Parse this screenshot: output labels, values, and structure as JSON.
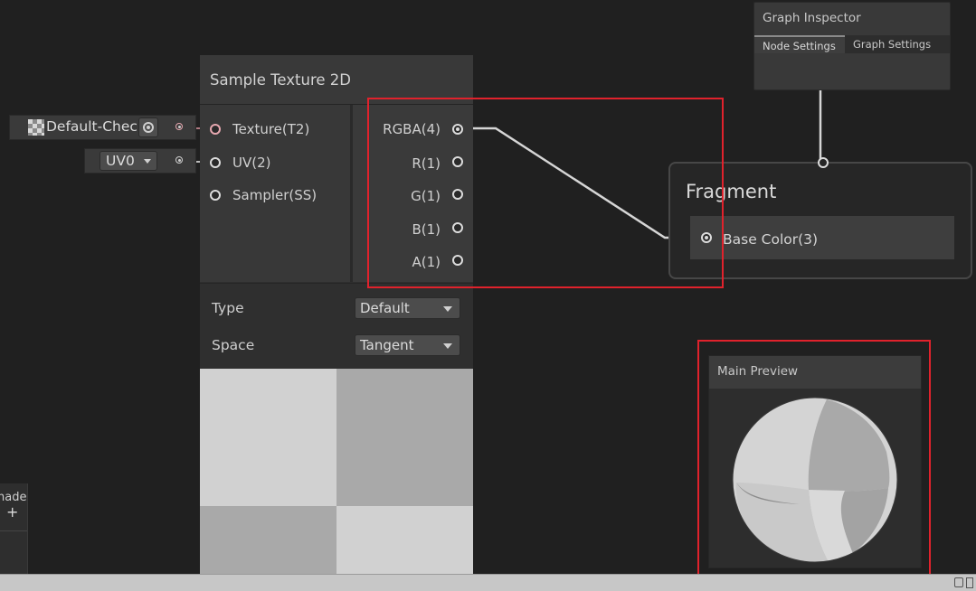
{
  "inspector": {
    "title": "Graph Inspector",
    "tabs": [
      "Node Settings",
      "Graph Settings"
    ]
  },
  "sample_node": {
    "title": "Sample Texture 2D",
    "inputs": [
      "Texture(T2)",
      "UV(2)",
      "Sampler(SS)"
    ],
    "outputs": [
      "RGBA(4)",
      "R(1)",
      "G(1)",
      "B(1)",
      "A(1)"
    ],
    "type_label": "Type",
    "type_value": "Default",
    "space_label": "Space",
    "space_value": "Tangent"
  },
  "inline_inputs": {
    "texture_value": "Default-Chec",
    "uv_value": "UV0"
  },
  "fragment": {
    "title": "Fragment",
    "base_color_label": "Base Color(3)"
  },
  "main_preview": {
    "title": "Main Preview"
  },
  "left_panel": {
    "label": "hade",
    "add_symbol": "+"
  },
  "colors": {
    "highlight": "#e0222c",
    "background": "#202020"
  }
}
